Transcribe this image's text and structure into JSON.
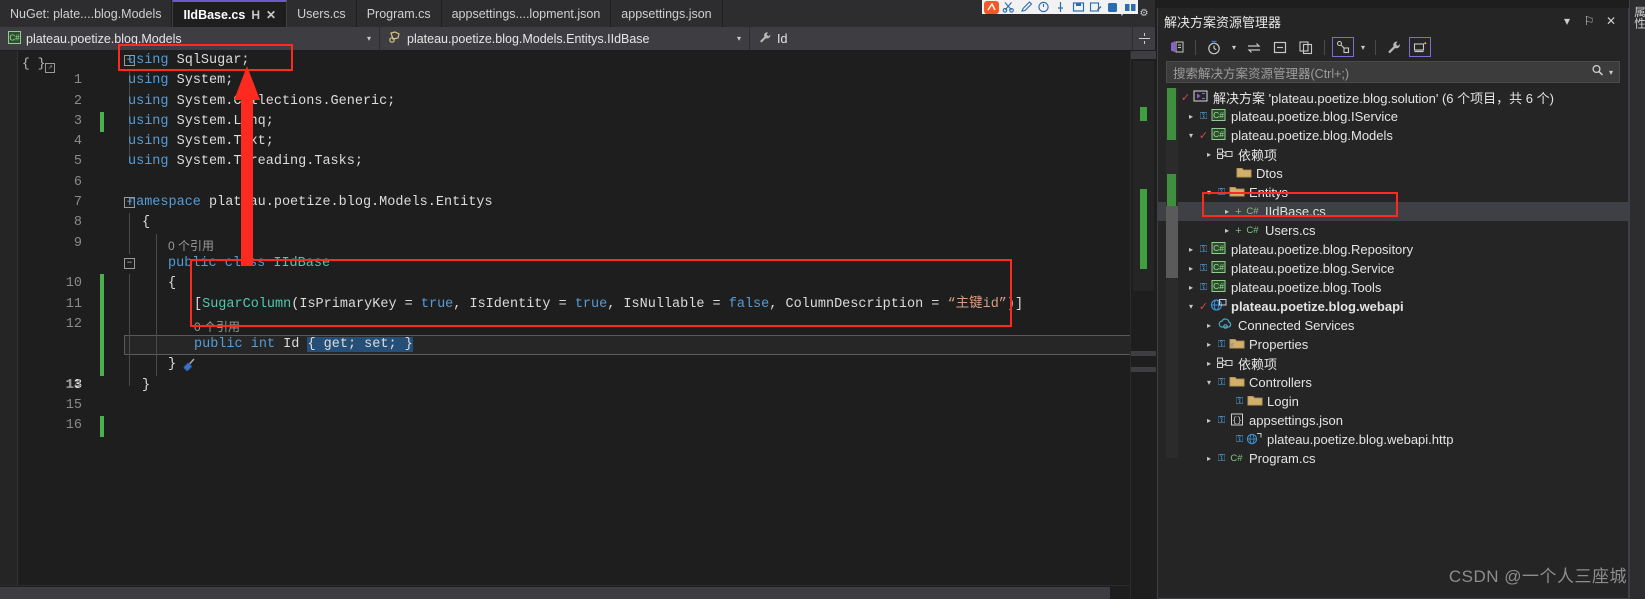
{
  "editor": {
    "tabs": [
      {
        "label": "NuGet: plate....blog.Models",
        "active": false,
        "pinned": false,
        "closable": false
      },
      {
        "label": "IIdBase.cs",
        "active": true,
        "pinned": true,
        "closable": true
      },
      {
        "label": "Users.cs",
        "active": false,
        "pinned": false,
        "closable": false
      },
      {
        "label": "Program.cs",
        "active": false,
        "pinned": false,
        "closable": false
      },
      {
        "label": "appsettings....lopment.json",
        "active": false,
        "pinned": false,
        "closable": false
      },
      {
        "label": "appsettings.json",
        "active": false,
        "pinned": false,
        "closable": false
      }
    ],
    "tabstrip_overflow_caret": "▼",
    "tabstrip_settings": "⚙",
    "navbar": {
      "project": "plateau.poetize.blog.Models",
      "type": "plateau.poetize.blog.Models.Entitys.IIdBase",
      "member": "Id",
      "caret": "▾",
      "project_icon": "csharp-project-icon",
      "type_icon": "class-icon",
      "member_icon": "property-icon"
    },
    "fold_brace_glyph": "{ }",
    "lines": [
      {
        "n": "1",
        "text": "using SqlSugar;"
      },
      {
        "n": "2",
        "text": "using System;"
      },
      {
        "n": "3",
        "text": "using System.Collections.Generic;"
      },
      {
        "n": "4",
        "text": "using System.Linq;"
      },
      {
        "n": "5",
        "text": "using System.Text;"
      },
      {
        "n": "6",
        "text": "using System.Threading.Tasks;"
      },
      {
        "n": "7",
        "text": ""
      },
      {
        "n": "8",
        "text": "namespace plateau.poetize.blog.Models.Entitys"
      },
      {
        "n": "9",
        "text": "{"
      },
      {
        "n": "",
        "text": "0 个引用"
      },
      {
        "n": "10",
        "text": "public class IIdBase"
      },
      {
        "n": "11",
        "text": "{"
      },
      {
        "n": "12",
        "text": "[SugarColumn(IsPrimaryKey = true, IsIdentity = true, IsNullable = false, ColumnDescription = “主键id”)]"
      },
      {
        "n": "",
        "text": "0 个引用"
      },
      {
        "n": "13",
        "text": "public int Id { get; set; }"
      },
      {
        "n": "14",
        "text": "}"
      },
      {
        "n": "15",
        "text": "}"
      },
      {
        "n": "16",
        "text": ""
      }
    ],
    "code_tokens": {
      "using": "using",
      "sqlsugar": "SqlSugar;",
      "system": "System;",
      "collections": "System.Collections.Generic;",
      "linq": "System.Linq;",
      "text": "System.Text;",
      "tasks": "System.Threading.Tasks;",
      "namespace_kw": "namespace",
      "namespace_name": "plateau.poetize.blog.Models.Entitys",
      "brace_open": "{",
      "brace_close": "}",
      "ref_count": "0 个引用",
      "public": "public",
      "class_kw": "class",
      "class_name": "IIdBase",
      "attr_open": "[",
      "attr_name": "SugarColumn",
      "attr_paren_open": "(",
      "p1": "IsPrimaryKey = ",
      "p1v": "true",
      "p2": ", IsIdentity = ",
      "p2v": "true",
      "p3": ", IsNullable = ",
      "p3v": "false",
      "p4": ", ColumnDescription = ",
      "p4v": "“主键id”",
      "attr_close": ")]",
      "int_kw": "int",
      "prop_name": "Id",
      "accessors": "{ get; set; }"
    }
  },
  "solution_explorer": {
    "title": "解决方案资源管理器",
    "window_controls": {
      "dropdown": "▾",
      "pin": "⚐",
      "close": "✕"
    },
    "toolbar_icons": [
      "home-solution-icon",
      "pending-changes-icon",
      "sync-with-active-document-icon",
      "collapse-all-icon",
      "show-all-files-icon",
      "view-class-diagram-icon",
      "properties-wrench-icon",
      "preview-selected-items-icon"
    ],
    "search_placeholder": "搜索解决方案资源管理器(Ctrl+;)",
    "search_icon": "search-icon",
    "search_caret": "▾",
    "tree": [
      {
        "label": "解决方案 'plateau.poetize.blog.solution' (6 个项目，共 6 个)",
        "indent": 0,
        "expander": "▴",
        "check": "✓",
        "icon": "solution-icon",
        "bold": false,
        "selected": false,
        "boxed": false
      },
      {
        "label": "plateau.poetize.blog.IService",
        "indent": 1,
        "expander": "▸",
        "lock": "⚿",
        "icon": "csharp-project-icon",
        "bold": false,
        "selected": false,
        "boxed": false
      },
      {
        "label": "plateau.poetize.blog.Models",
        "indent": 1,
        "expander": "▾",
        "check": "✓",
        "icon": "csharp-project-icon",
        "bold": false,
        "selected": false,
        "boxed": false
      },
      {
        "label": "依赖项",
        "indent": 2,
        "expander": "▸",
        "icon": "dependencies-icon",
        "bold": false,
        "selected": false,
        "boxed": false
      },
      {
        "label": "Dtos",
        "indent": 3,
        "expander": "",
        "icon": "folder-icon",
        "bold": false,
        "selected": false,
        "boxed": false
      },
      {
        "label": "Entitys",
        "indent": 2,
        "expander": "▾",
        "lock": "⚿",
        "icon": "folder-icon",
        "bold": false,
        "selected": false,
        "boxed": false
      },
      {
        "label": "IIdBase.cs",
        "indent": 3,
        "expander": "▸",
        "plus": "+",
        "icon": "csharp-file-icon",
        "bold": false,
        "selected": true,
        "boxed": true
      },
      {
        "label": "Users.cs",
        "indent": 3,
        "expander": "▸",
        "plus": "+",
        "icon": "csharp-file-icon",
        "bold": false,
        "selected": false,
        "boxed": false
      },
      {
        "label": "plateau.poetize.blog.Repository",
        "indent": 1,
        "expander": "▸",
        "lock": "⚿",
        "icon": "csharp-project-icon",
        "bold": false,
        "selected": false,
        "boxed": false
      },
      {
        "label": "plateau.poetize.blog.Service",
        "indent": 1,
        "expander": "▸",
        "lock": "⚿",
        "icon": "csharp-project-icon",
        "bold": false,
        "selected": false,
        "boxed": false
      },
      {
        "label": "plateau.poetize.blog.Tools",
        "indent": 1,
        "expander": "▸",
        "lock": "⚿",
        "icon": "csharp-project-icon",
        "bold": false,
        "selected": false,
        "boxed": false
      },
      {
        "label": "plateau.poetize.blog.webapi",
        "indent": 1,
        "expander": "▾",
        "check": "✓",
        "icon": "web-project-icon",
        "bold": true,
        "selected": false,
        "boxed": false
      },
      {
        "label": "Connected Services",
        "indent": 2,
        "expander": "▸",
        "icon": "connected-services-icon",
        "bold": false,
        "selected": false,
        "boxed": false
      },
      {
        "label": "Properties",
        "indent": 2,
        "expander": "▸",
        "lock": "⚿",
        "icon": "properties-folder-icon",
        "bold": false,
        "selected": false,
        "boxed": false
      },
      {
        "label": "依赖项",
        "indent": 2,
        "expander": "▸",
        "icon": "dependencies-icon",
        "bold": false,
        "selected": false,
        "boxed": false
      },
      {
        "label": "Controllers",
        "indent": 2,
        "expander": "▾",
        "lock": "⚿",
        "icon": "folder-icon",
        "bold": false,
        "selected": false,
        "boxed": false
      },
      {
        "label": "Login",
        "indent": 3,
        "expander": "",
        "lock": "⚿",
        "icon": "folder-icon",
        "bold": false,
        "selected": false,
        "boxed": false
      },
      {
        "label": "appsettings.json",
        "indent": 2,
        "expander": "▸",
        "lock": "⚿",
        "icon": "json-file-icon",
        "bold": false,
        "selected": false,
        "boxed": false
      },
      {
        "label": "plateau.poetize.blog.webapi.http",
        "indent": 3,
        "expander": "",
        "lock": "⚿",
        "icon": "http-file-icon",
        "bold": false,
        "selected": false,
        "boxed": false
      },
      {
        "label": "Program.cs",
        "indent": 2,
        "expander": "▸",
        "lock": "⚿",
        "icon": "csharp-file-icon",
        "bold": false,
        "selected": false,
        "boxed": false
      }
    ]
  },
  "right_dock_tab": {
    "label": "属性"
  },
  "watermark": {
    "text": "CSDN @一个人三座城"
  },
  "colors": {
    "accent_tab": "#6a5acd",
    "annotation_red": "#fc2a1f",
    "keyword_blue": "#569cd6",
    "type_teal": "#4ec9b0",
    "string_orange": "#d69d85",
    "selection_blue": "#264f78",
    "changebar_green": "#4caf50",
    "editor_bg": "#1e1e1e",
    "chrome_bg": "#2d2d30"
  }
}
